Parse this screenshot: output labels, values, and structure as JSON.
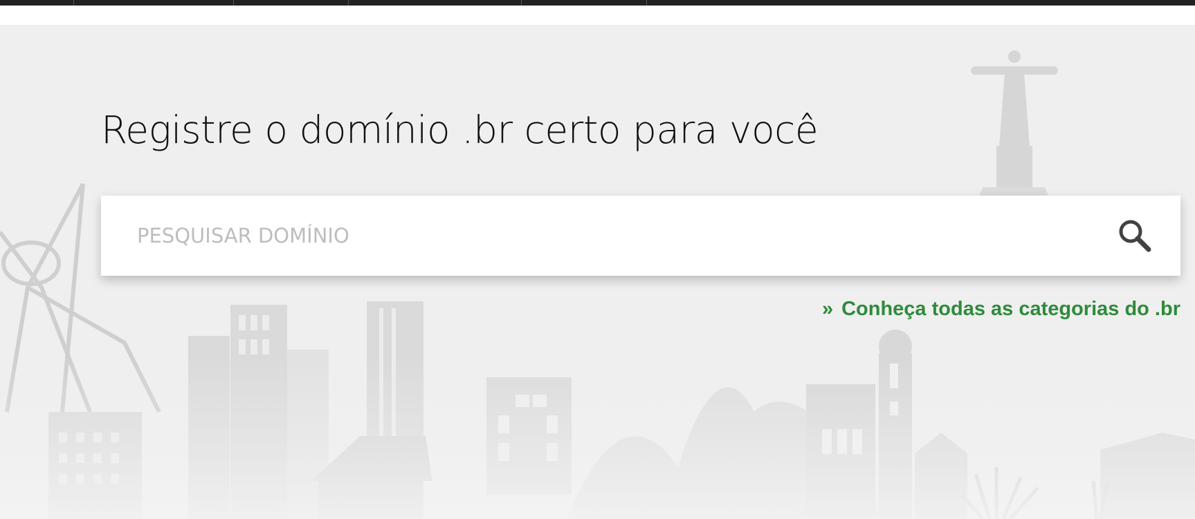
{
  "header": {
    "bar_color": "#222222"
  },
  "hero": {
    "title": "Registre o domínio .br certo para você",
    "background_color": "#efefef",
    "background_illustration": "brazil-city-skyline"
  },
  "search": {
    "placeholder": "PESQUISAR DOMÍNIO",
    "value": "",
    "icon": "search-icon"
  },
  "categories_link": {
    "arrow": "»",
    "label": "Conheça todas as categorias do .br",
    "color": "#2e8b3a"
  }
}
